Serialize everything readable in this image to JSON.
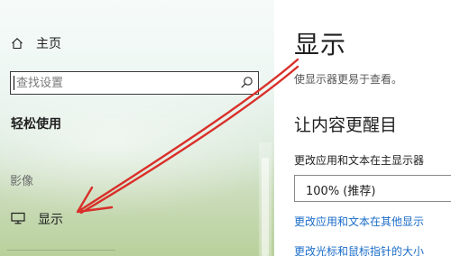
{
  "sidebar": {
    "home_label": "主页",
    "search_placeholder": "查找设置",
    "section_title": "轻松使用",
    "category_label": "影像",
    "nav_display_label": "显示"
  },
  "main": {
    "title": "显示",
    "subtitle": "使显示器更易于查看。",
    "section_heading": "让内容更醒目",
    "setting_label": "更改应用和文本在主显示器",
    "select_value": "100% (推荐)",
    "link_other_displays": "更改应用和文本在其他显示",
    "link_pointer": "更改光标和鼠标指针的大小"
  },
  "colors": {
    "annotation_arrow": "#d92f2a",
    "link": "#1a6cc8"
  }
}
